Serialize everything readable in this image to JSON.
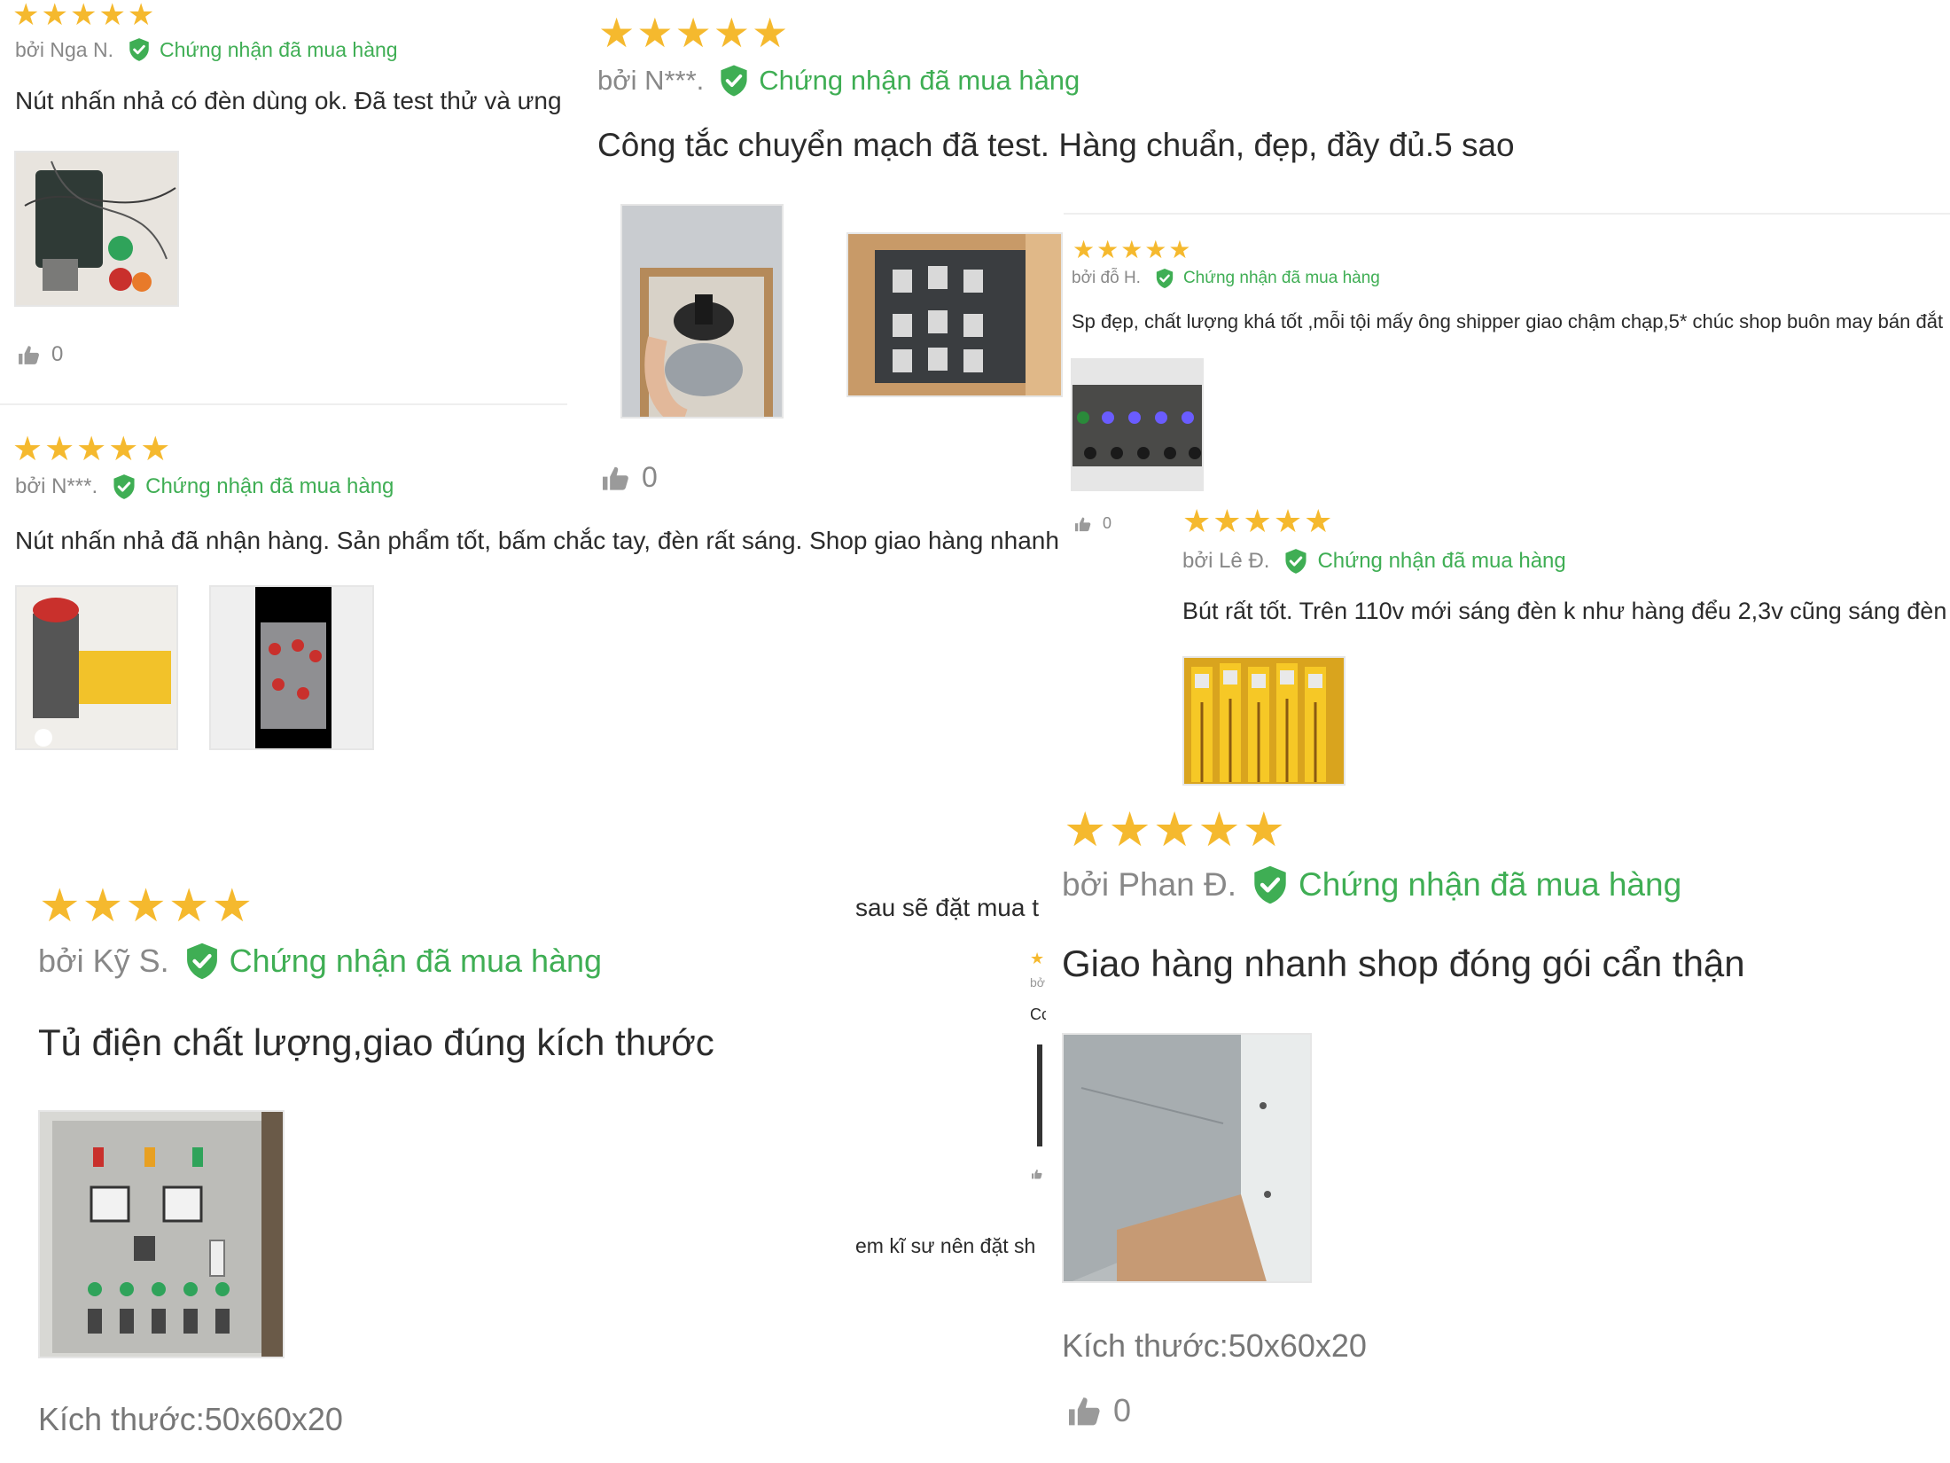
{
  "common": {
    "stars": "★★★★★",
    "verified": "Chứng nhận đã mua hàng",
    "colors": {
      "star": "#f5b92e",
      "verified": "#3fae54",
      "muted": "#888888"
    }
  },
  "reviews": [
    {
      "author": "bởi Nga N.",
      "text": "Nút nhấn nhả có đèn dùng ok. Đã test thử và ưng",
      "likes": "0"
    },
    {
      "author": "bởi N***.",
      "text": "Công tắc chuyển mạch đã test. Hàng chuẩn, đẹp, đầy đủ.5 sao",
      "likes": "0"
    },
    {
      "author": "bởi đỗ H.",
      "text": "Sp đẹp, chất lượng khá tốt ,mỗi tội mấy ông shipper giao chậm chạp,5* chúc shop buôn may bán đắt",
      "likes": "0"
    },
    {
      "author": "bởi N***.",
      "text": "Nút nhấn nhả đã nhận hàng. Sản phẩm tốt, bấm chắc tay, đèn rất sáng. Shop giao hàng nhanh"
    },
    {
      "author": "bởi Lê Đ.",
      "text": "Bút rất tốt. Trên 110v mới sáng đèn k như hàng đểu 2,3v cũng sáng đèn"
    },
    {
      "author": "bởi Kỹ S.",
      "text": "Tủ điện chất lượng,giao đúng kích thước",
      "size": "Kích thước:50x60x20"
    },
    {
      "author": "bởi Phan Đ.",
      "text": "Giao hàng nhanh shop đóng gói cẩn thận",
      "size": "Kích thước:50x60x20",
      "likes": "0"
    }
  ],
  "fragments": {
    "middle_top": "sau sẽ đặt mua t",
    "middle_bottom": "em kĩ sư nên đặt sh",
    "tiny_author": "bở",
    "tiny_text": "Cc"
  }
}
